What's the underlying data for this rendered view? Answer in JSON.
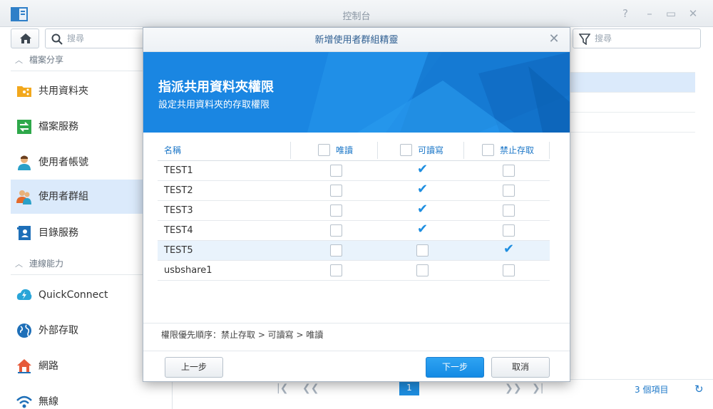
{
  "window": {
    "title": "控制台"
  },
  "sidebar": {
    "search_placeholder": "搜尋",
    "sections": [
      {
        "label": "檔案分享"
      },
      {
        "label": "連線能力"
      }
    ],
    "items": [
      {
        "label": "共用資料夾"
      },
      {
        "label": "檔案服務"
      },
      {
        "label": "使用者帳號"
      },
      {
        "label": "使用者群組"
      },
      {
        "label": "目錄服務"
      },
      {
        "label": "QuickConnect"
      },
      {
        "label": "外部存取"
      },
      {
        "label": "網路"
      },
      {
        "label": "無線"
      }
    ]
  },
  "content": {
    "filter_placeholder": "搜尋",
    "pager": {
      "current_page": "1",
      "count_label": "3 個項目"
    }
  },
  "wizard": {
    "title": "新增使用者群組精靈",
    "banner_title": "指派共用資料夾權限",
    "banner_subtitle": "設定共用資料夾的存取權限",
    "columns": {
      "name": "名稱",
      "readonly": "唯讀",
      "readwrite": "可讀寫",
      "noaccess": "禁止存取"
    },
    "rows": [
      {
        "name": "TEST1",
        "readonly": false,
        "readwrite": true,
        "noaccess": false
      },
      {
        "name": "TEST2",
        "readonly": false,
        "readwrite": true,
        "noaccess": false
      },
      {
        "name": "TEST3",
        "readonly": false,
        "readwrite": true,
        "noaccess": false
      },
      {
        "name": "TEST4",
        "readonly": false,
        "readwrite": true,
        "noaccess": false
      },
      {
        "name": "TEST5",
        "readonly": false,
        "readwrite": false,
        "noaccess": true
      },
      {
        "name": "usbshare1",
        "readonly": false,
        "readwrite": false,
        "noaccess": false
      }
    ],
    "priority_note": "權限優先順序：禁止存取 > 可讀寫 > 唯讀",
    "buttons": {
      "back": "上一步",
      "next": "下一步",
      "cancel": "取消"
    }
  },
  "colors": {
    "accent": "#1e8ee0",
    "banner": "#1b8ae6",
    "selected_row": "#dbeafb"
  }
}
